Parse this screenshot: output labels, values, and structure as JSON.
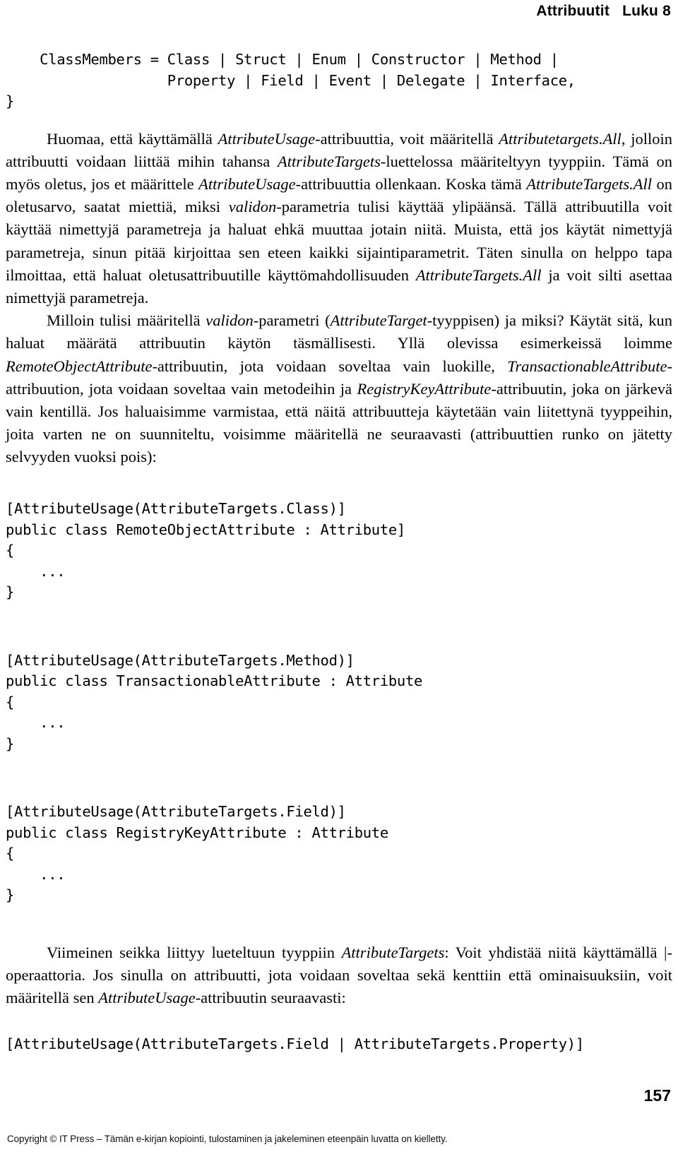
{
  "running_head": {
    "chapter_title": "Attribuutit",
    "chapter_label": "Luku 8",
    "full": "Attribuutit   Luku 8"
  },
  "code_blocks": {
    "enum_tail": "    ClassMembers = Class | Struct | Enum | Constructor | Method |\n                   Property | Field | Event | Delegate | Interface,\n}",
    "remote_object": "[AttributeUsage(AttributeTargets.Class)]\npublic class RemoteObjectAttribute : Attribute]\n{\n    ...\n}",
    "transactionable": "[AttributeUsage(AttributeTargets.Method)]\npublic class TransactionableAttribute : Attribute\n{\n    ...\n}",
    "registry_key": "[AttributeUsage(AttributeTargets.Field)]\npublic class RegistryKeyAttribute : Attribute\n{\n    ...\n}",
    "combined_targets": "[AttributeUsage(AttributeTargets.Field | AttributeTargets.Property)]"
  },
  "paragraphs": {
    "p1_part1": "Huomaa, että käyttämällä ",
    "p1_em1": "AttributeUsage",
    "p1_part2": "-attribuuttia, voit määritellä ",
    "p1_em2": "Attributetargets.All",
    "p1_part3": ", jolloin attribuutti voidaan liittää mihin tahansa ",
    "p1_em3": "AttributeTargets",
    "p1_part4": "-luettelossa määriteltyyn tyyppiin. Tämä on myös oletus, jos et määrittele ",
    "p1_em4": "AttributeUsage",
    "p1_part5": "-attribuuttia ollenkaan. Koska tämä ",
    "p1_em5": "AttributeTargets.All",
    "p1_part6": " on oletusarvo, saatat miettiä, miksi ",
    "p1_em6": "validon",
    "p1_part7": "-parametria tulisi käyttää ylipäänsä. Tällä attribuutilla voit käyttää nimettyjä parametreja ja haluat ehkä muuttaa jotain niitä. Muista, että jos käytät nimettyjä parametreja, sinun pitää kirjoittaa sen eteen kaikki sijaintiparametrit. Täten sinulla on helppo tapa ilmoittaa, että haluat oletusattribuutille käyttömahdollisuuden ",
    "p1_em7": "AttributeTargets.All",
    "p1_part8": " ja voit silti asettaa nimettyjä parametreja.",
    "p2_part1": "Milloin tulisi määritellä ",
    "p2_em1": "validon",
    "p2_part2": "-parametri (",
    "p2_em2": "AttributeTarget",
    "p2_part3": "-tyyppisen) ja miksi? Käytät sitä, kun haluat määrätä attribuutin käytön täsmällisesti. Yllä olevissa esimerkeissä loimme ",
    "p2_em3": "RemoteObjectAttribute",
    "p2_part4": "-attribuutin, jota voidaan soveltaa vain luokille, ",
    "p2_em4": "TransactionableAttribute",
    "p2_part5": "-attribuution, jota voidaan soveltaa vain metodeihin ja ",
    "p2_em5": "RegistryKeyAttribute",
    "p2_part6": "-attribuutin, joka on järkevä vain kentillä. Jos haluaisimme varmistaa, että näitä attribuutteja käytetään vain liitettynä tyyppeihin, joita varten ne on suunniteltu, voisimme määritellä ne seuraavasti (attribuuttien runko on jätetty selvyyden vuoksi pois):",
    "p3_part1": "Viimeinen seikka liittyy lueteltuun tyyppiin ",
    "p3_em1": "AttributeTargets",
    "p3_part2": ": Voit yhdistää niitä käyttämällä |-operaattoria. Jos sinulla on attribuutti, jota voidaan soveltaa sekä kenttiin että ominaisuuksiin, voit määritellä sen ",
    "p3_em2": "AttributeUsage",
    "p3_part3": "-attribuutin seuraavasti:"
  },
  "folio": "157",
  "footer": "Copyright © IT Press – Tämän e-kirjan kopiointi, tulostaminen ja jakeleminen eteenpäin luvatta on kielletty.",
  "colors": {
    "page_background": "#ffffff",
    "text": "#000000",
    "footer_text": "#111111"
  }
}
